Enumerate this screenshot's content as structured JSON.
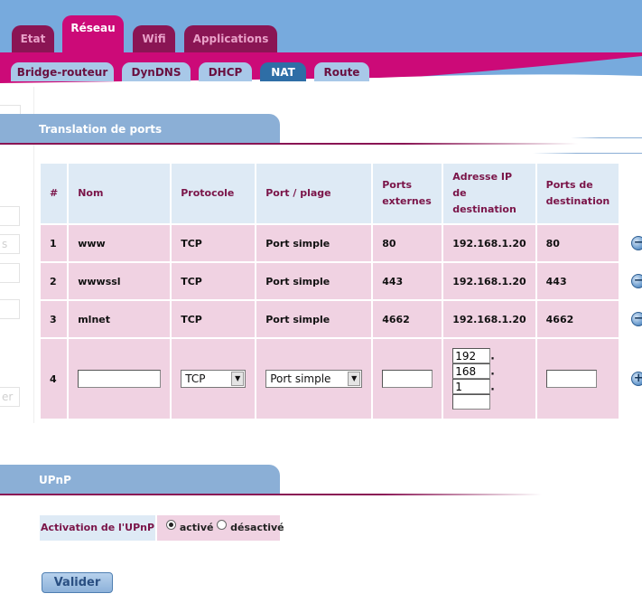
{
  "main_tabs": [
    {
      "label": "Etat"
    },
    {
      "label": "Réseau",
      "active": true
    },
    {
      "label": "Wifi"
    },
    {
      "label": "Applications"
    }
  ],
  "sub_tabs": [
    {
      "label": "Bridge-routeur"
    },
    {
      "label": "DynDNS"
    },
    {
      "label": "DHCP"
    },
    {
      "label": "NAT",
      "active": true
    },
    {
      "label": "Route"
    }
  ],
  "left_panel": {
    "ghost_1": "s",
    "ghost_2": "er"
  },
  "port_translation": {
    "title": "Translation de ports",
    "headers": {
      "num": "#",
      "name": "Nom",
      "protocol": "Protocole",
      "port_range": "Port / plage",
      "ext_ports_1": "Ports",
      "ext_ports_2": "externes",
      "dest_ip_1": "Adresse IP",
      "dest_ip_2": "de",
      "dest_ip_3": "destination",
      "dest_ports_1": "Ports de",
      "dest_ports_2": "destination"
    },
    "rows": [
      {
        "num": "1",
        "name": "www",
        "protocol": "TCP",
        "port_type": "Port simple",
        "ext_port": "80",
        "dest_ip": "192.168.1.20",
        "dest_port": "80"
      },
      {
        "num": "2",
        "name": "wwwssl",
        "protocol": "TCP",
        "port_type": "Port simple",
        "ext_port": "443",
        "dest_ip": "192.168.1.20",
        "dest_port": "443"
      },
      {
        "num": "3",
        "name": "mlnet",
        "protocol": "TCP",
        "port_type": "Port simple",
        "ext_port": "4662",
        "dest_ip": "192.168.1.20",
        "dest_port": "4662"
      }
    ],
    "new_row": {
      "num": "4",
      "name_value": "",
      "protocol_selected": "TCP",
      "port_type_selected": "Port simple",
      "ext_port_value": "",
      "ip_octet_1": "192",
      "ip_octet_2": "168",
      "ip_octet_3": "1",
      "ip_octet_4": "",
      "ip_sep": ".",
      "dest_port_value": ""
    },
    "remove_symbol": "−",
    "add_symbol": "+"
  },
  "upnp": {
    "title": "UPnP",
    "label": "Activation de l'UPnP",
    "option_on": "activé",
    "option_off": "désactivé",
    "selected": "activé"
  },
  "submit_label": "Valider",
  "colors": {
    "header_blue": "#77aadd",
    "brand_magenta": "#cc0a78",
    "tab_dark": "#8a1554",
    "subtab_active": "#2e6ea6",
    "section_blue": "#8bafd6",
    "row_pink": "#f0d2e2",
    "header_cell": "#deeaf5"
  }
}
